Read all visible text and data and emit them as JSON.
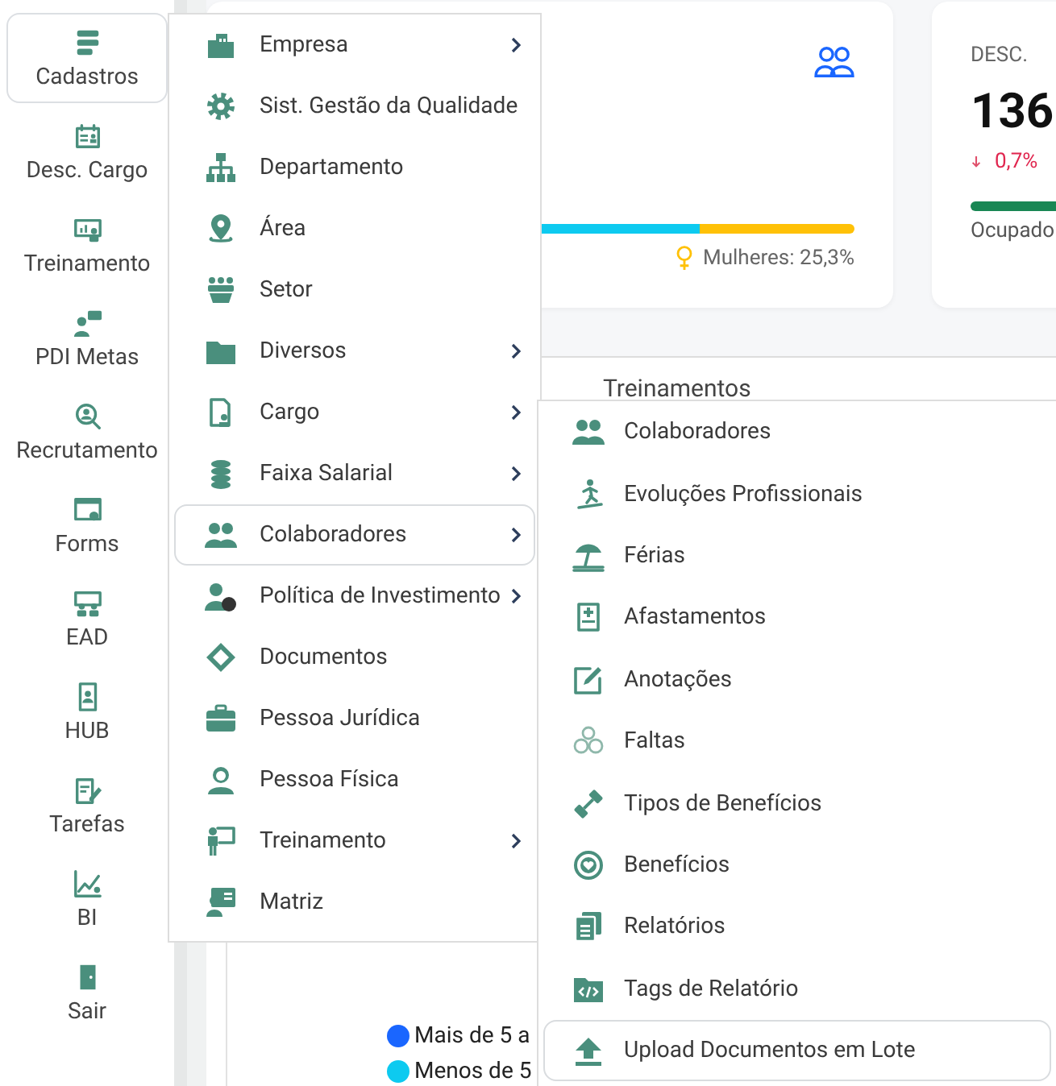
{
  "sidebar": {
    "items": [
      {
        "label": "Cadastros",
        "selected": true
      },
      {
        "label": "Desc. Cargo",
        "selected": false
      },
      {
        "label": "Treinamento",
        "selected": false
      },
      {
        "label": "PDI Metas",
        "selected": false
      },
      {
        "label": "Recrutamento",
        "selected": false
      },
      {
        "label": "Forms",
        "selected": false
      },
      {
        "label": "EAD",
        "selected": false
      },
      {
        "label": "HUB",
        "selected": false
      },
      {
        "label": "Tarefas",
        "selected": false
      },
      {
        "label": "BI",
        "selected": false
      },
      {
        "label": "Sair",
        "selected": false
      }
    ]
  },
  "headcount_card": {
    "gender_bar": {
      "level": 0.747
    },
    "women_label": "Mulheres: 25,3%"
  },
  "job_card": {
    "title": "DESC.",
    "value": "136",
    "change": "0,7%",
    "status": "Ocupado"
  },
  "panel": {
    "tabs": [
      {
        "label": "Treinamentos"
      }
    ],
    "legend": [
      {
        "label": "Mais de 5 a",
        "color": "#1a66ff"
      },
      {
        "label": "Menos de 5",
        "color": "#0dcaf0"
      }
    ]
  },
  "menu": {
    "items": [
      {
        "label": "Empresa",
        "submenu": true,
        "selected": false
      },
      {
        "label": "Sist. Gestão da Qualidade",
        "submenu": false,
        "selected": false
      },
      {
        "label": "Departamento",
        "submenu": false,
        "selected": false
      },
      {
        "label": "Área",
        "submenu": false,
        "selected": false
      },
      {
        "label": "Setor",
        "submenu": false,
        "selected": false
      },
      {
        "label": "Diversos",
        "submenu": true,
        "selected": false
      },
      {
        "label": "Cargo",
        "submenu": true,
        "selected": false
      },
      {
        "label": "Faixa Salarial",
        "submenu": true,
        "selected": false
      },
      {
        "label": "Colaboradores",
        "submenu": true,
        "selected": true
      },
      {
        "label": "Política de Investimento",
        "submenu": true,
        "selected": false
      },
      {
        "label": "Documentos",
        "submenu": false,
        "selected": false
      },
      {
        "label": "Pessoa Jurídica",
        "submenu": false,
        "selected": false
      },
      {
        "label": "Pessoa Física",
        "submenu": false,
        "selected": false
      },
      {
        "label": "Treinamento",
        "submenu": true,
        "selected": false
      },
      {
        "label": "Matriz",
        "submenu": false,
        "selected": false
      }
    ]
  },
  "submenu": {
    "items": [
      {
        "label": "Colaboradores",
        "selected": false
      },
      {
        "label": "Evoluções Profissionais",
        "selected": false
      },
      {
        "label": "Férias",
        "selected": false
      },
      {
        "label": "Afastamentos",
        "selected": false
      },
      {
        "label": "Anotações",
        "selected": false
      },
      {
        "label": "Faltas",
        "selected": false
      },
      {
        "label": "Tipos de Benefícios",
        "selected": false
      },
      {
        "label": "Benefícios",
        "selected": false
      },
      {
        "label": "Relatórios",
        "selected": false
      },
      {
        "label": "Tags de Relatório",
        "selected": false
      },
      {
        "label": "Upload Documentos em Lote",
        "selected": true
      }
    ]
  }
}
